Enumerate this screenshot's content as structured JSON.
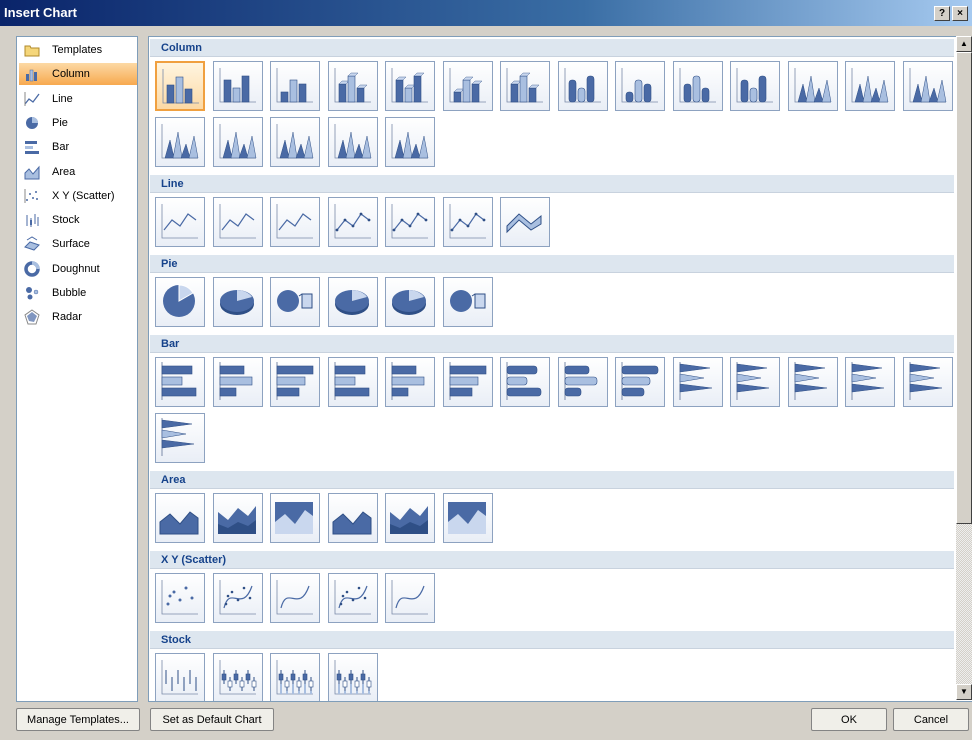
{
  "window": {
    "title": "Insert Chart",
    "help_label": "?",
    "close_label": "×"
  },
  "categories": [
    {
      "label": "Templates",
      "icon": "folder-icon"
    },
    {
      "label": "Column",
      "icon": "column-chart-icon",
      "selected": true
    },
    {
      "label": "Line",
      "icon": "line-chart-icon"
    },
    {
      "label": "Pie",
      "icon": "pie-chart-icon"
    },
    {
      "label": "Bar",
      "icon": "bar-chart-icon"
    },
    {
      "label": "Area",
      "icon": "area-chart-icon"
    },
    {
      "label": "X Y (Scatter)",
      "icon": "scatter-chart-icon"
    },
    {
      "label": "Stock",
      "icon": "stock-chart-icon"
    },
    {
      "label": "Surface",
      "icon": "surface-chart-icon"
    },
    {
      "label": "Doughnut",
      "icon": "doughnut-chart-icon"
    },
    {
      "label": "Bubble",
      "icon": "bubble-chart-icon"
    },
    {
      "label": "Radar",
      "icon": "radar-chart-icon"
    }
  ],
  "sections": [
    {
      "title": "Column",
      "kind": "column",
      "count": 19
    },
    {
      "title": "Line",
      "kind": "line",
      "count": 7
    },
    {
      "title": "Pie",
      "kind": "pie",
      "count": 6
    },
    {
      "title": "Bar",
      "kind": "bar",
      "count": 15
    },
    {
      "title": "Area",
      "kind": "area",
      "count": 6
    },
    {
      "title": "X Y (Scatter)",
      "kind": "scatter",
      "count": 5
    },
    {
      "title": "Stock",
      "kind": "stock",
      "count": 4
    }
  ],
  "buttons": {
    "manage_templates": "Manage Templates...",
    "set_default": "Set as Default Chart",
    "ok": "OK",
    "cancel": "Cancel"
  },
  "colors": {
    "accent": "#4a6aa5",
    "selection": "#f7a94f",
    "section_text": "#15428b"
  }
}
